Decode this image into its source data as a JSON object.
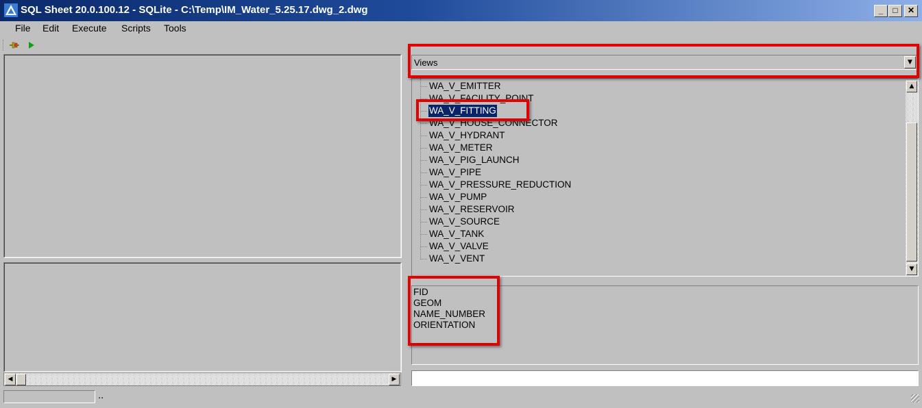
{
  "window": {
    "title": "SQL Sheet 20.0.100.12 - SQLite - C:\\Temp\\IM_Water_5.25.17.dwg_2.dwg",
    "min_label": "_",
    "max_label": "□",
    "close_label": "✕"
  },
  "menu": {
    "items": [
      "File",
      "Edit",
      "Execute",
      "Scripts",
      "Tools"
    ]
  },
  "toolbar": {
    "icons": [
      "connect-icon",
      "run-icon"
    ]
  },
  "views": {
    "selected": "Views"
  },
  "tree": {
    "items": [
      "WA_V_EMITTER",
      "WA_V_FACILITY_POINT",
      "WA_V_FITTING",
      "WA_V_HOUSE_CONNECTOR",
      "WA_V_HYDRANT",
      "WA_V_METER",
      "WA_V_PIG_LAUNCH",
      "WA_V_PIPE",
      "WA_V_PRESSURE_REDUCTION",
      "WA_V_PUMP",
      "WA_V_RESERVOIR",
      "WA_V_SOURCE",
      "WA_V_TANK",
      "WA_V_VALVE",
      "WA_V_VENT"
    ],
    "selected_index": 2
  },
  "fields": {
    "items": [
      "FID",
      "GEOM",
      "NAME_NUMBER",
      "ORIENTATION"
    ]
  },
  "status": {
    "text": ".."
  },
  "colors": {
    "highlight": "#e00000",
    "selection": "#0a246a",
    "window_bg": "#c0c0c0"
  }
}
